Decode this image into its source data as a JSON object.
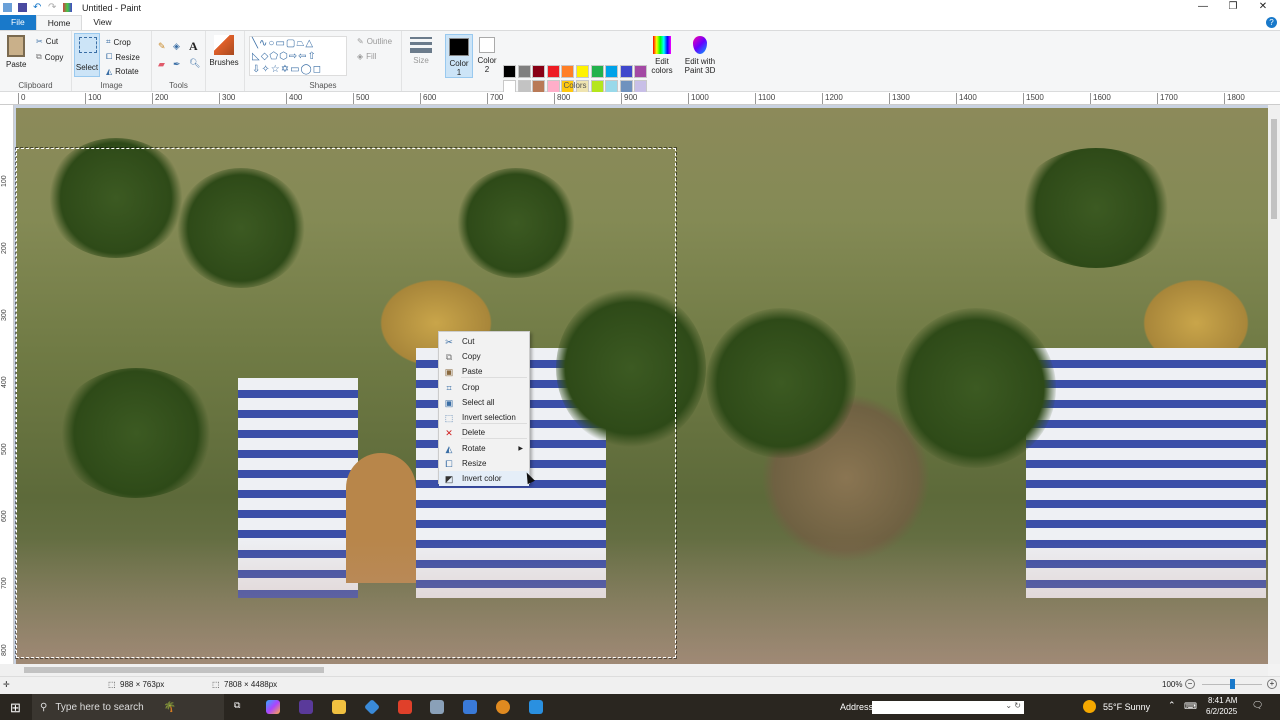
{
  "window": {
    "title": "Untitled - Paint",
    "minimize": "—",
    "maximize": "❐",
    "close": "✕"
  },
  "tabs": [
    "File",
    "Home",
    "View"
  ],
  "ribbon": {
    "clipboard": {
      "label": "Clipboard",
      "paste": "Paste",
      "cut": "Cut",
      "copy": "Copy"
    },
    "image": {
      "label": "Image",
      "select": "Select",
      "crop": "Crop",
      "resize": "Resize",
      "rotate": "Rotate"
    },
    "tools": {
      "label": "Tools"
    },
    "brushes": "Brushes",
    "shapes": {
      "label": "Shapes",
      "outline": "Outline",
      "fill": "Fill"
    },
    "size": "Size",
    "color1": "Color 1",
    "color2": "Color 2",
    "colors_label": "Colors",
    "edit_colors": "Edit colors",
    "edit_paint3d": "Edit with Paint 3D",
    "palette_row1": [
      "#000000",
      "#7f7f7f",
      "#880015",
      "#ed1c24",
      "#ff7f27",
      "#fff200",
      "#22b14c",
      "#00a2e8",
      "#3f48cc",
      "#a349a4"
    ],
    "palette_row2": [
      "#ffffff",
      "#c3c3c3",
      "#b97a57",
      "#ffaec9",
      "#ffc90e",
      "#efe4b0",
      "#b5e61d",
      "#99d9ea",
      "#7092be",
      "#c8bfe7"
    ]
  },
  "rulers": {
    "horizontal": [
      "0",
      "100",
      "200",
      "300",
      "400",
      "500",
      "600",
      "700",
      "800",
      "900",
      "1000",
      "1100",
      "1200",
      "1300",
      "1400",
      "1500",
      "1600",
      "1700",
      "1800"
    ],
    "vertical": [
      "100",
      "200",
      "300",
      "400",
      "500",
      "600",
      "700",
      "800"
    ]
  },
  "context_menu": {
    "items": [
      "Cut",
      "Copy",
      "Paste",
      "Crop",
      "Select all",
      "Invert selection",
      "Delete",
      "Rotate",
      "Resize",
      "Invert color"
    ],
    "highlighted": "Invert color"
  },
  "status": {
    "selection_size": "988 × 763px",
    "image_size": "7808 × 4488px",
    "zoom": "100%",
    "zoom_fraction": 0.5
  },
  "taskbar": {
    "search_placeholder": "Type here to search",
    "address_label": "Address",
    "weather": "55°F  Sunny",
    "time": "8:41 AM",
    "date": "6/2/2025"
  }
}
